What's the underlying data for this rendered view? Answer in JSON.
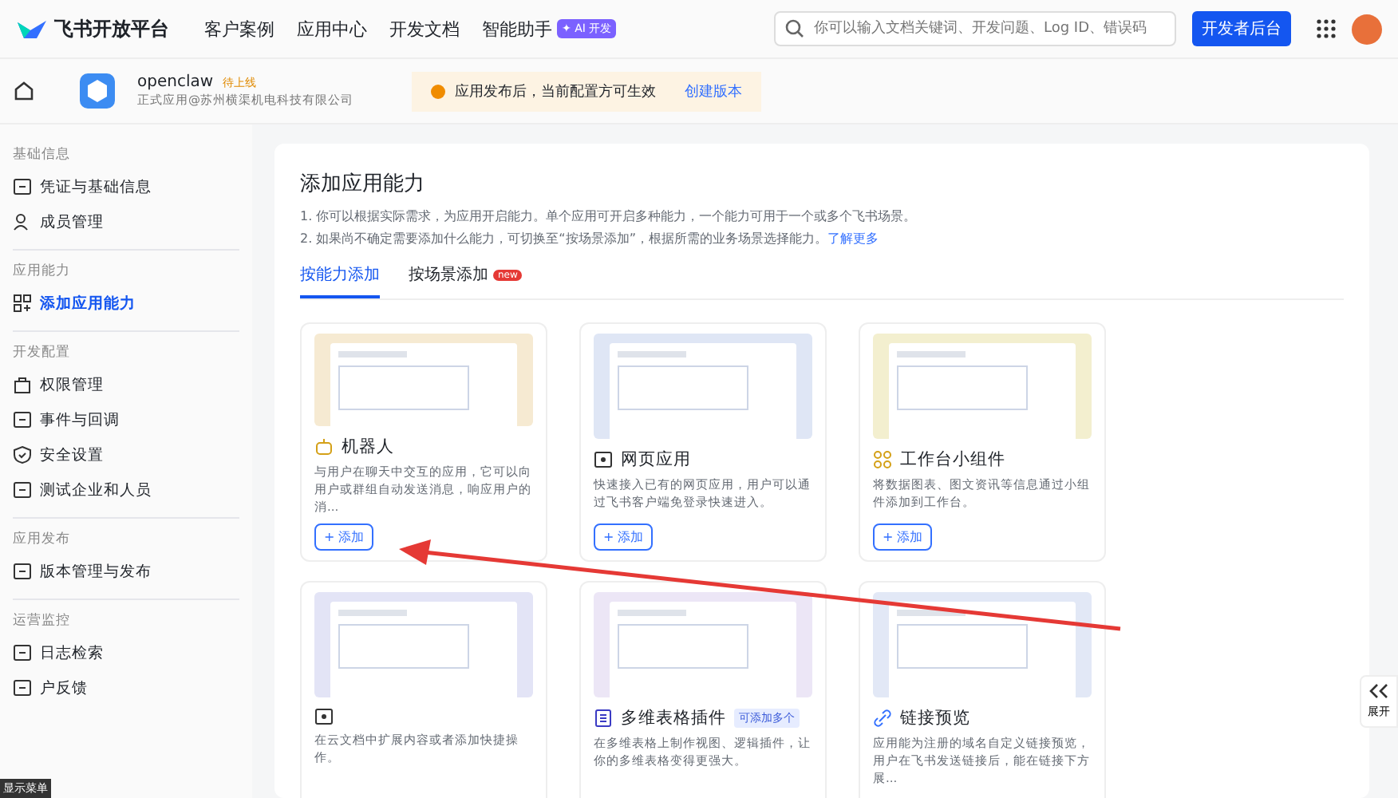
{
  "header": {
    "brand": "飞书开放平台",
    "nav": [
      {
        "label": "客户案例"
      },
      {
        "label": "应用中心"
      },
      {
        "label": "开发文档"
      },
      {
        "label": "智能助手",
        "badge": "✦ AI 开发"
      }
    ],
    "search": {
      "placeholder": "你可以输入文档关键词、开发问题、Log ID、错误码"
    },
    "console_button": "开发者后台"
  },
  "app_bar": {
    "name": "openclaw",
    "status": "待上线",
    "subtitle": "正式应用@苏州横渠机电科技有限公司",
    "notice": "应用发布后，当前配置方可生效",
    "notice_action": "创建版本"
  },
  "sidebar": {
    "groups": [
      {
        "title": "基础信息",
        "items": [
          {
            "label": "凭证与基础信息",
            "selected": false
          },
          {
            "label": "成员管理",
            "selected": false
          }
        ]
      },
      {
        "title": "应用能力",
        "items": [
          {
            "label": "添加应用能力",
            "selected": true
          }
        ]
      },
      {
        "title": "开发配置",
        "items": [
          {
            "label": "权限管理",
            "selected": false
          },
          {
            "label": "事件与回调",
            "selected": false
          },
          {
            "label": "安全设置",
            "selected": false
          },
          {
            "label": "测试企业和人员",
            "selected": false
          }
        ]
      },
      {
        "title": "应用发布",
        "items": [
          {
            "label": "版本管理与发布",
            "selected": false
          }
        ]
      },
      {
        "title": "运营监控",
        "items": [
          {
            "label": "日志检索",
            "selected": false
          },
          {
            "label": "户反馈",
            "selected": false
          }
        ]
      }
    ],
    "tooltip": "显示菜单"
  },
  "main": {
    "title": "添加应用能力",
    "notes": [
      "1. 你可以根据实际需求，为应用开启能力。单个应用可开启多种能力，一个能力可用于一个或多个飞书场景。",
      "2. 如果尚不确定需要添加什么能力，可切换至“按场景添加”，根据所需的业务场景选择能力。"
    ],
    "learn_more": "了解更多",
    "tabs": [
      {
        "label": "按能力添加",
        "selected": true
      },
      {
        "label": "按场景添加",
        "badge": "new",
        "selected": false
      }
    ],
    "cards": [
      {
        "title": "机器人",
        "description": "与用户在聊天中交互的应用，它可以向用户或群组自动发送消息，响应用户的消...",
        "add": "+ 添加"
      },
      {
        "title": "网页应用",
        "description": "快速接入已有的网页应用，用户可以通过飞书客户端免登录快速进入。",
        "add": "+ 添加"
      },
      {
        "title": "工作台小组件",
        "description": "将数据图表、图文资讯等信息通过小组件添加到工作台。",
        "add": "+ 添加"
      },
      {
        "description": "在云文档中扩展内容或者添加快捷操作。"
      },
      {
        "title": "多维表格插件",
        "tag": "可添加多个",
        "description": "在多维表格上制作视图、逻辑插件，让你的多维表格变得更强大。"
      },
      {
        "title": "链接预览",
        "description": "应用能为注册的域名自定义链接预览，用户在飞书发送链接后，能在链接下方展..."
      }
    ]
  },
  "expand_button": "展开"
}
